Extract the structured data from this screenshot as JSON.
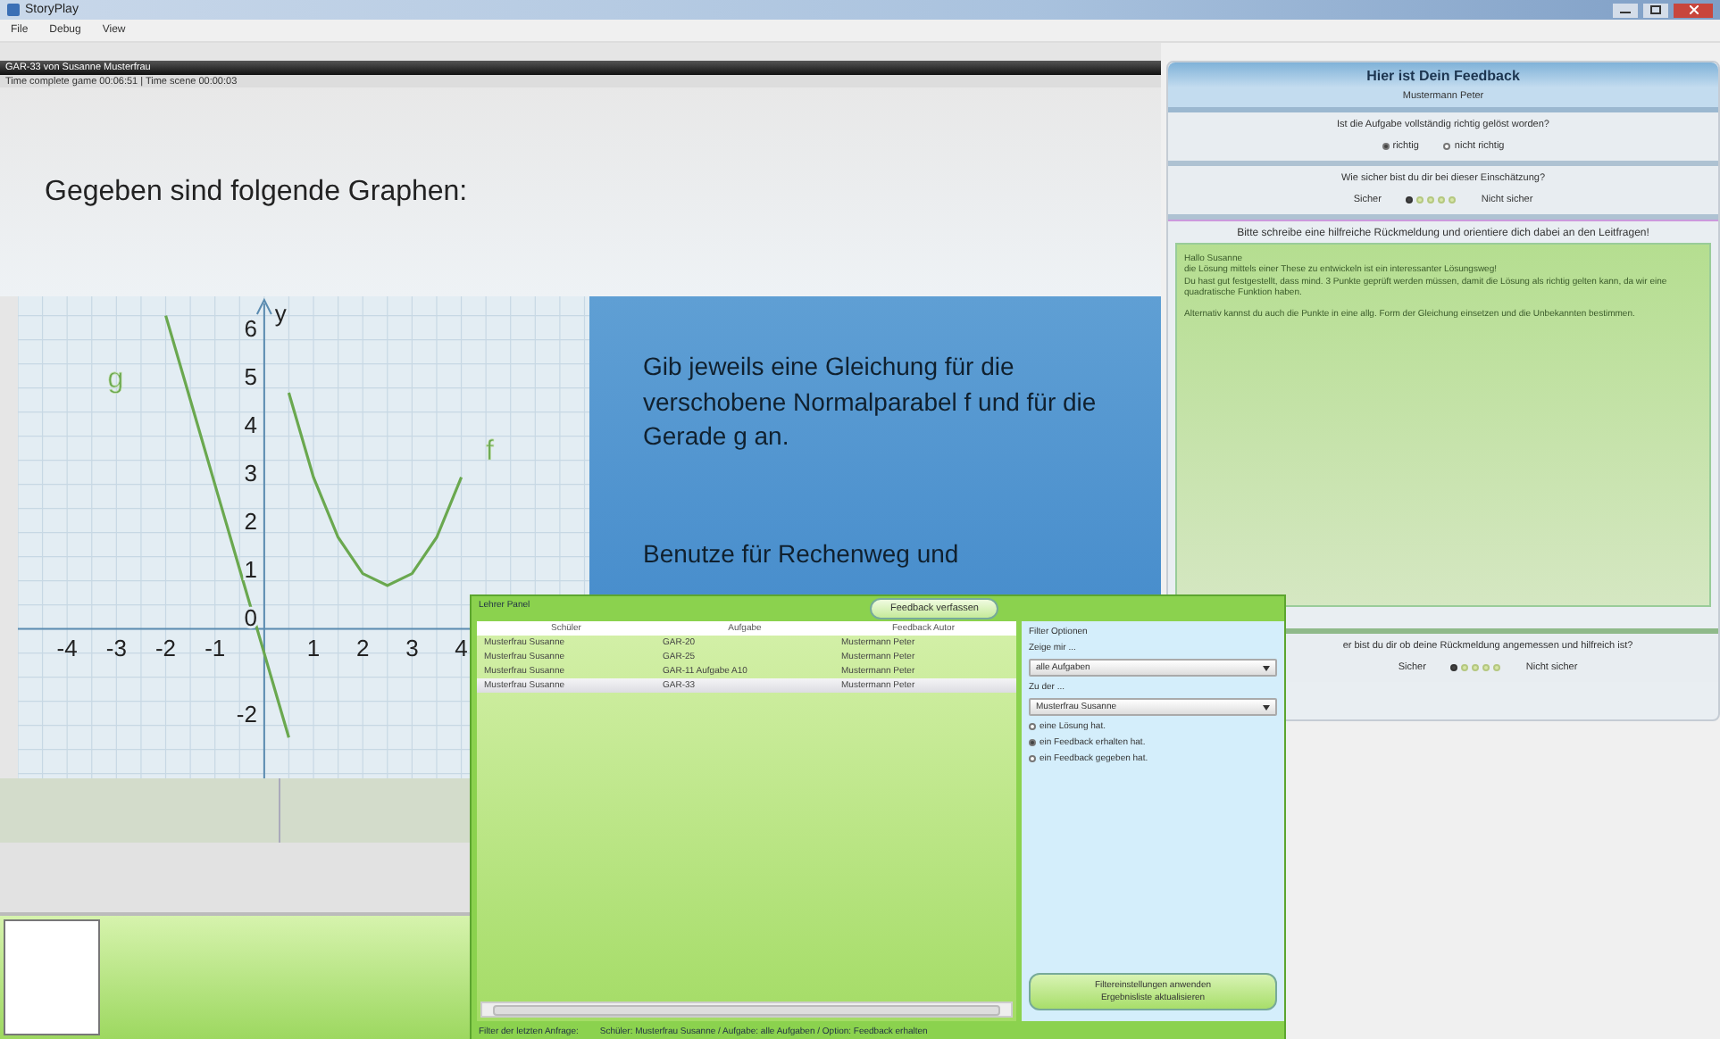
{
  "window": {
    "title": "StoryPlay"
  },
  "menu": [
    {
      "label": "File"
    },
    {
      "label": "Debug"
    },
    {
      "label": "View"
    }
  ],
  "scene": {
    "header": "GAR-33 von Susanne Musterfrau",
    "timer": "Time complete game 00:06:51 | Time scene 00:00:03",
    "heading": "Gegeben sind folgende Graphen:",
    "task": "Gib jeweils eine Gleichung für die verschobene Normalparabel f und für die Gerade g an.",
    "hint": "Benutze für Rechenweg und",
    "chart_data": {
      "type": "line",
      "x": [
        -2,
        -1.5,
        -1,
        -0.5,
        0,
        0.5,
        1,
        1.5,
        2,
        2.5,
        3,
        3.5,
        4
      ],
      "ylabel": "y",
      "grid": true,
      "series": [
        {
          "name": "g",
          "color": "#6aa84f",
          "values": [
            6.5,
            4.75,
            3,
            1.25,
            -0.5,
            -2.25,
            null,
            null,
            null,
            null,
            null,
            null,
            null
          ]
        },
        {
          "name": "f",
          "color": "#6aa84f",
          "values": [
            null,
            null,
            null,
            null,
            null,
            4.9,
            3.15,
            1.9,
            1.15,
            0.9,
            1.15,
            1.9,
            3.15
          ]
        }
      ],
      "xlim": [
        -5,
        6.6
      ],
      "ylim": [
        -3.1,
        6.9
      ],
      "xticks": [
        -4,
        -3,
        -2,
        -1,
        1,
        2,
        3,
        4
      ],
      "yticks": [
        -2,
        0,
        1,
        2,
        3,
        4,
        5,
        6
      ]
    }
  },
  "feedback": {
    "title": "Hier ist Dein Feedback",
    "author": "Mustermann Peter",
    "q1": {
      "question": "Ist die Aufgabe vollständig richtig gelöst worden?",
      "options": [
        {
          "label": "richtig",
          "selected": true
        },
        {
          "label": "nicht richtig",
          "selected": false
        }
      ]
    },
    "q2": {
      "question": "Wie sicher bist du dir bei dieser Einschätzung?",
      "low": "Sicher",
      "high": "Nicht sicher",
      "scale": [
        {
          "selected": true
        },
        {
          "selected": false
        },
        {
          "selected": false
        },
        {
          "selected": false
        },
        {
          "selected": false
        }
      ]
    },
    "prompt": "Bitte schreibe eine hilfreiche Rückmeldung und orientiere dich dabei an den Leitfragen!",
    "text": [
      [
        "Hallo Susanne",
        "die Lösung mittels einer These zu entwickeln ist ein interessanter Lösungsweg!",
        "Du hast gut festgestellt, dass mind. 3 Punkte geprüft werden müssen, damit die Lösung als richtig gelten kann, da wir eine quadratische Funktion haben."
      ],
      [
        "Alternativ kannst du auch die Punkte in eine allg. Form der Gleichung einsetzen und die Unbekannten bestimmen."
      ]
    ],
    "q3": {
      "question": "er bist du dir ob deine Rückmeldung angemessen und hilfreich ist?",
      "low": "Sicher",
      "high": "Nicht sicher",
      "scale": [
        {
          "selected": true
        },
        {
          "selected": false
        },
        {
          "selected": false
        },
        {
          "selected": false
        },
        {
          "selected": false
        }
      ]
    }
  },
  "teacher_panel": {
    "title": "Lehrer Panel",
    "action": "Feedback verfassen",
    "table": {
      "columns": [
        "Schüler",
        "Aufgabe",
        "Feedback Autor"
      ],
      "rows": [
        {
          "cells": [
            "Musterfrau Susanne",
            "GAR-20",
            "Mustermann Peter"
          ],
          "selected": false
        },
        {
          "cells": [
            "Musterfrau Susanne",
            "GAR-25",
            "Mustermann Peter"
          ],
          "selected": false
        },
        {
          "cells": [
            "Musterfrau Susanne",
            "GAR-11 Aufgabe A10",
            "Mustermann Peter"
          ],
          "selected": false
        },
        {
          "cells": [
            "Musterfrau Susanne",
            "GAR-33",
            "Mustermann Peter"
          ],
          "selected": true
        }
      ]
    },
    "filter": {
      "title": "Filter Optionen",
      "show_label": "Zeige mir ...",
      "show_value": "alle Aufgaben",
      "for_label": "Zu der ...",
      "for_value": "Musterfrau Susanne",
      "options": [
        {
          "label": "eine Lösung hat.",
          "selected": false
        },
        {
          "label": "ein Feedback erhalten hat.",
          "selected": true
        },
        {
          "label": "ein Feedback gegeben hat.",
          "selected": false
        }
      ],
      "apply": [
        "Filtereinstellungen anwenden",
        "Ergebnisliste aktualisieren"
      ]
    },
    "status": {
      "label": "Filter der letzten Anfrage:",
      "value": "Schüler: Musterfrau Susanne / Aufgabe: alle Aufgaben / Option: Feedback erhalten"
    }
  }
}
